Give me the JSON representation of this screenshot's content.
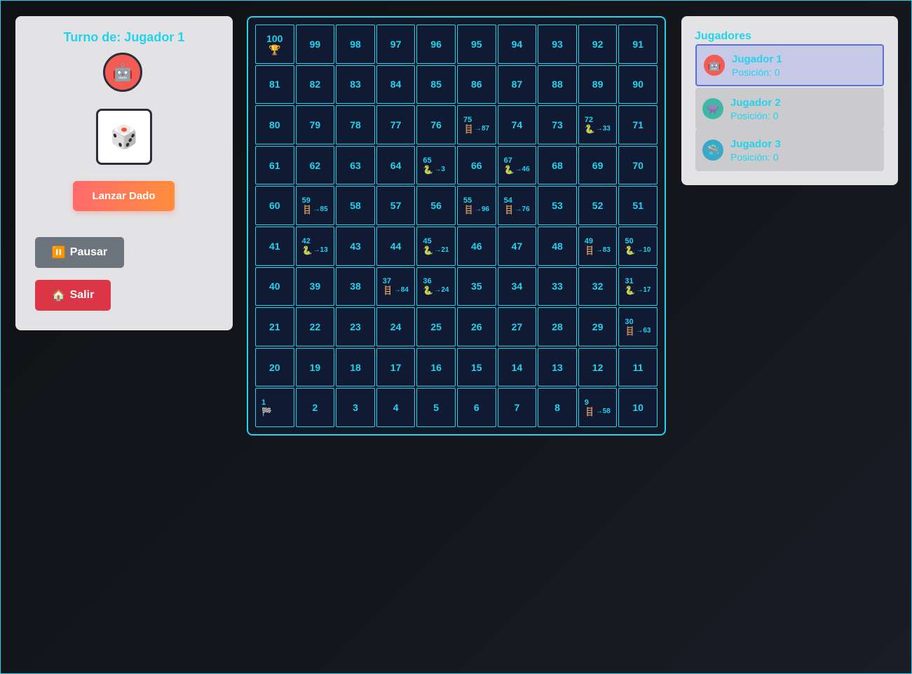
{
  "turn": {
    "label": "Turno de: Jugador 1",
    "avatar_icon": "🤖",
    "avatar_color": "#f25c54"
  },
  "dice": {
    "face_icon": "🎲"
  },
  "controls": {
    "roll_label": "Lanzar Dado",
    "pause_icon": "⏸️",
    "pause_label": "Pausar",
    "exit_icon": "🏠",
    "exit_label": "Salir"
  },
  "board": {
    "rows": [
      [
        {
          "n": "100",
          "icon": "🏆"
        },
        {
          "n": "99"
        },
        {
          "n": "98"
        },
        {
          "n": "97"
        },
        {
          "n": "96"
        },
        {
          "n": "95"
        },
        {
          "n": "94"
        },
        {
          "n": "93"
        },
        {
          "n": "92"
        },
        {
          "n": "91"
        }
      ],
      [
        {
          "n": "81"
        },
        {
          "n": "82"
        },
        {
          "n": "83"
        },
        {
          "n": "84"
        },
        {
          "n": "85"
        },
        {
          "n": "86"
        },
        {
          "n": "87"
        },
        {
          "n": "88"
        },
        {
          "n": "89"
        },
        {
          "n": "90"
        }
      ],
      [
        {
          "n": "80"
        },
        {
          "n": "79"
        },
        {
          "n": "78"
        },
        {
          "n": "77"
        },
        {
          "n": "76"
        },
        {
          "n": "75",
          "kind": "ladder",
          "to": "→87"
        },
        {
          "n": "74"
        },
        {
          "n": "73"
        },
        {
          "n": "72",
          "kind": "snake",
          "to": "→33"
        },
        {
          "n": "71"
        }
      ],
      [
        {
          "n": "61"
        },
        {
          "n": "62"
        },
        {
          "n": "63"
        },
        {
          "n": "64"
        },
        {
          "n": "65",
          "kind": "snake",
          "to": "→3"
        },
        {
          "n": "66"
        },
        {
          "n": "67",
          "kind": "snake",
          "to": "→46"
        },
        {
          "n": "68"
        },
        {
          "n": "69"
        },
        {
          "n": "70"
        }
      ],
      [
        {
          "n": "60"
        },
        {
          "n": "59",
          "kind": "ladder",
          "to": "→85"
        },
        {
          "n": "58"
        },
        {
          "n": "57"
        },
        {
          "n": "56"
        },
        {
          "n": "55",
          "kind": "ladder",
          "to": "→96"
        },
        {
          "n": "54",
          "kind": "ladder",
          "to": "→76"
        },
        {
          "n": "53"
        },
        {
          "n": "52"
        },
        {
          "n": "51"
        }
      ],
      [
        {
          "n": "41"
        },
        {
          "n": "42",
          "kind": "snake",
          "to": "→13"
        },
        {
          "n": "43"
        },
        {
          "n": "44"
        },
        {
          "n": "45",
          "kind": "snake",
          "to": "→21"
        },
        {
          "n": "46"
        },
        {
          "n": "47"
        },
        {
          "n": "48"
        },
        {
          "n": "49",
          "kind": "ladder",
          "to": "→83"
        },
        {
          "n": "50",
          "kind": "snake",
          "to": "→10"
        }
      ],
      [
        {
          "n": "40"
        },
        {
          "n": "39"
        },
        {
          "n": "38"
        },
        {
          "n": "37",
          "kind": "ladder",
          "to": "→84"
        },
        {
          "n": "36",
          "kind": "snake",
          "to": "→24"
        },
        {
          "n": "35"
        },
        {
          "n": "34"
        },
        {
          "n": "33"
        },
        {
          "n": "32"
        },
        {
          "n": "31",
          "kind": "snake",
          "to": "→17"
        }
      ],
      [
        {
          "n": "21"
        },
        {
          "n": "22"
        },
        {
          "n": "23"
        },
        {
          "n": "24"
        },
        {
          "n": "25"
        },
        {
          "n": "26"
        },
        {
          "n": "27"
        },
        {
          "n": "28"
        },
        {
          "n": "29"
        },
        {
          "n": "30",
          "kind": "ladder",
          "to": "→63"
        }
      ],
      [
        {
          "n": "20"
        },
        {
          "n": "19"
        },
        {
          "n": "18"
        },
        {
          "n": "17"
        },
        {
          "n": "16"
        },
        {
          "n": "15"
        },
        {
          "n": "14"
        },
        {
          "n": "13"
        },
        {
          "n": "12"
        },
        {
          "n": "11"
        }
      ],
      [
        {
          "n": "1",
          "kind": "start",
          "icon": "🏁"
        },
        {
          "n": "2"
        },
        {
          "n": "3"
        },
        {
          "n": "4"
        },
        {
          "n": "5"
        },
        {
          "n": "6"
        },
        {
          "n": "7"
        },
        {
          "n": "8"
        },
        {
          "n": "9",
          "kind": "ladder",
          "to": "→58"
        },
        {
          "n": "10"
        }
      ]
    ],
    "icons": {
      "ladder": "🪜",
      "snake": "🐍"
    }
  },
  "players": {
    "title": "Jugadores",
    "list": [
      {
        "name": "Jugador 1",
        "position": "Posición: 0",
        "icon": "🤖",
        "color": "#f25c54",
        "active": true
      },
      {
        "name": "Jugador 2",
        "position": "Posición: 0",
        "icon": "👾",
        "color": "#3fb8a8",
        "active": false
      },
      {
        "name": "Jugador 3",
        "position": "Posición: 0",
        "icon": "🛸",
        "color": "#3aa8c8",
        "active": false
      }
    ]
  }
}
